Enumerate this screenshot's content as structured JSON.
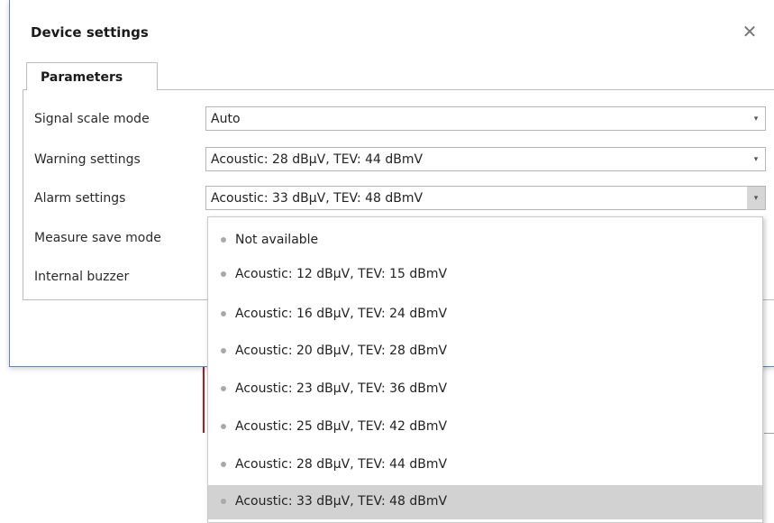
{
  "dialog": {
    "title": "Device settings",
    "close_label": "✕",
    "tab_label": "Parameters"
  },
  "params": [
    {
      "label": "Signal scale mode",
      "value": "Auto"
    },
    {
      "label": "Warning settings",
      "value": "Acoustic: 28 dBµV, TEV: 44 dBmV"
    },
    {
      "label": "Alarm settings",
      "value": "Acoustic: 33 dBµV, TEV: 48 dBmV"
    },
    {
      "label": "Measure save mode"
    },
    {
      "label": "Internal buzzer"
    }
  ],
  "dropdown_icon": "▾",
  "dropdown": {
    "items": [
      "Not available",
      "Acoustic: 12 dBµV, TEV: 15 dBmV",
      "Acoustic: 16 dBµV, TEV: 24 dBmV",
      "Acoustic: 20 dBµV, TEV: 28 dBmV",
      "Acoustic: 23 dBµV, TEV: 36 dBmV",
      "Acoustic: 25 dBµV, TEV: 42 dBmV",
      "Acoustic: 28 dBµV, TEV: 44 dBmV",
      "Acoustic: 33 dBµV, TEV: 48 dBmV"
    ],
    "selected": "Acoustic: 33 dBµV, TEV: 48 dBmV"
  },
  "colors": {
    "dialog_border": "#5a86c6",
    "selected_item": "#d2d2d2",
    "background_accent": "#b21b1b"
  }
}
